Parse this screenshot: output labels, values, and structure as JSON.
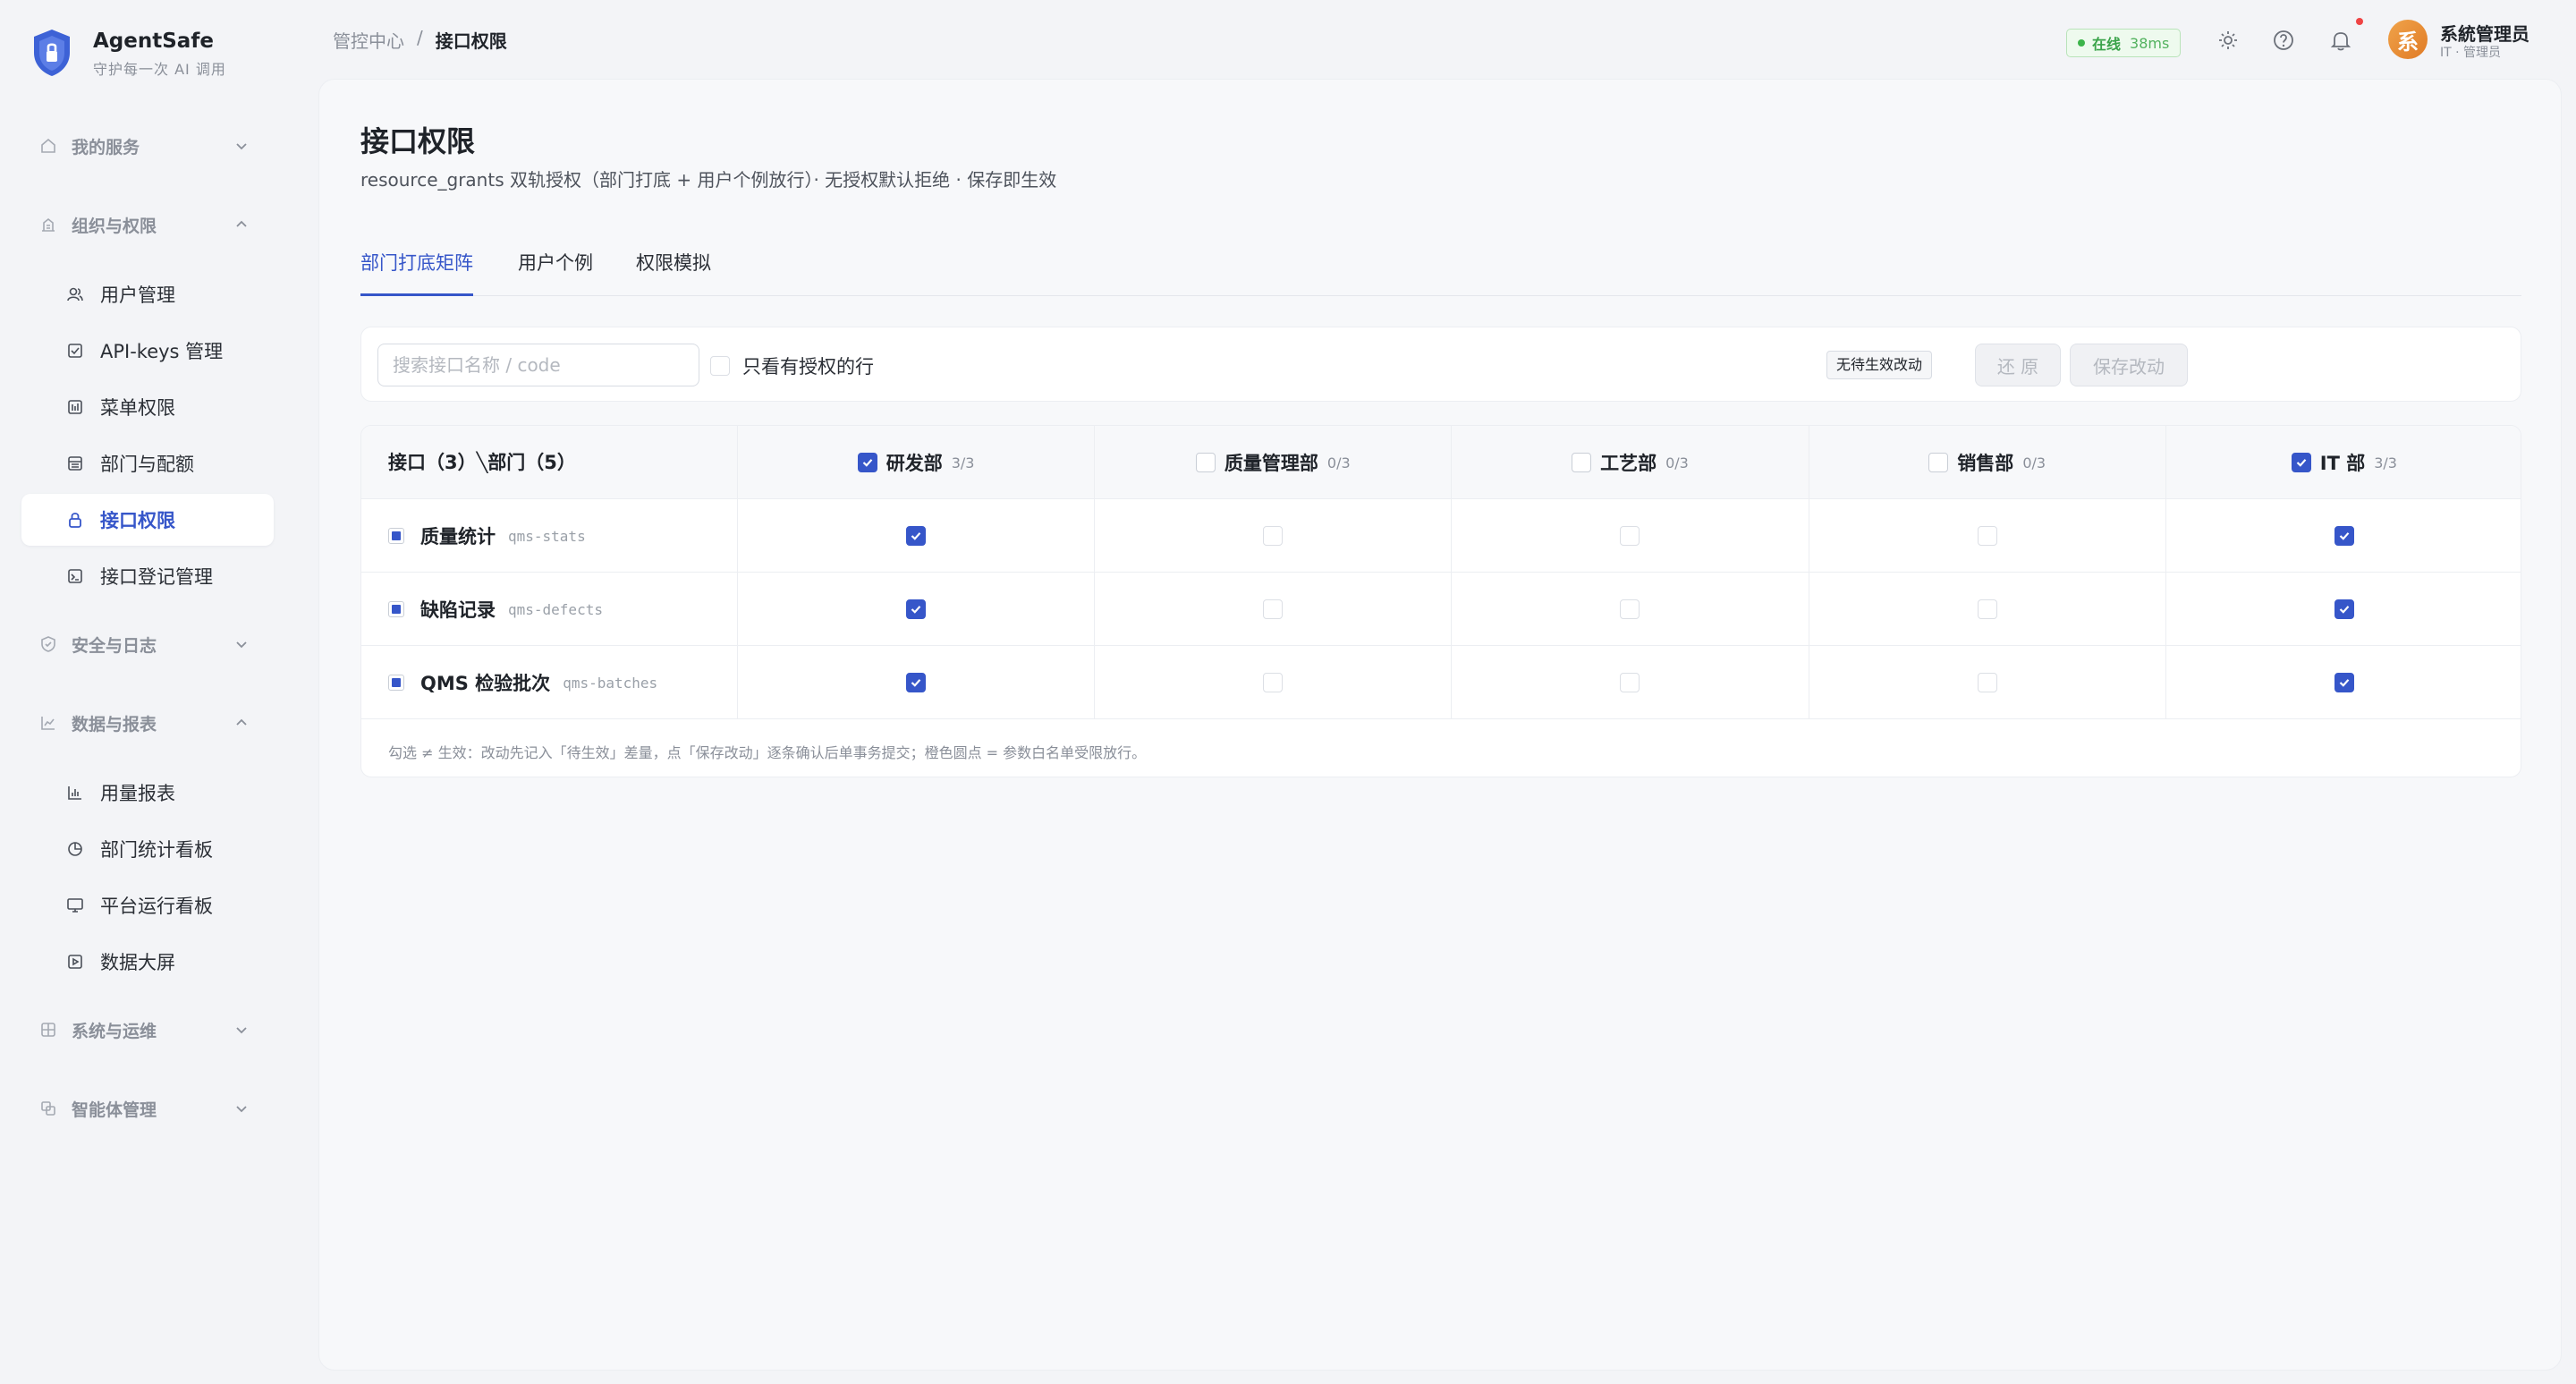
{
  "app": {
    "name": "AgentSafe",
    "slogan": "守护每一次 AI 调用"
  },
  "sidebar": {
    "groups": [
      {
        "label": "我的服务",
        "icon": "home-icon",
        "expanded": false
      },
      {
        "label": "组织与权限",
        "icon": "building-icon",
        "expanded": true,
        "items": [
          {
            "label": "用户管理",
            "icon": "users-icon"
          },
          {
            "label": "API-keys 管理",
            "icon": "key-check-icon"
          },
          {
            "label": "菜单权限",
            "icon": "menu-grid-icon"
          },
          {
            "label": "部门与配额",
            "icon": "department-icon"
          },
          {
            "label": "接口权限",
            "icon": "lock-icon",
            "active": true
          },
          {
            "label": "接口登记管理",
            "icon": "terminal-icon"
          }
        ]
      },
      {
        "label": "安全与日志",
        "icon": "shield-icon",
        "expanded": false
      },
      {
        "label": "数据与报表",
        "icon": "chart-line-icon",
        "expanded": true,
        "items": [
          {
            "label": "用量报表",
            "icon": "bar-chart-icon"
          },
          {
            "label": "部门统计看板",
            "icon": "pie-chart-icon"
          },
          {
            "label": "平台运行看板",
            "icon": "monitor-icon"
          },
          {
            "label": "数据大屏",
            "icon": "play-screen-icon"
          }
        ]
      },
      {
        "label": "系统与运维",
        "icon": "server-icon",
        "expanded": false
      },
      {
        "label": "智能体管理",
        "icon": "agent-icon",
        "expanded": false
      }
    ]
  },
  "breadcrumb": {
    "parent": "管控中心",
    "sep": "/",
    "current": "接口权限"
  },
  "topbar": {
    "status": "在线",
    "latency": "38ms",
    "status_color": "#3aa34a",
    "avatar_char": "系",
    "user_name": "系統管理员",
    "user_role": "IT · 管理员"
  },
  "page": {
    "title": "接口权限",
    "subtitle": "resource_grants 双轨授权（部门打底 + 用户个例放行）· 无授权默认拒绝 · 保存即生效"
  },
  "tabs": [
    {
      "label": "部门打底矩阵",
      "active": true
    },
    {
      "label": "用户个例",
      "active": false
    },
    {
      "label": "权限模拟",
      "active": false
    }
  ],
  "toolbar": {
    "search_placeholder": "搜索接口名称 / code",
    "search_value": "",
    "only_granted_label": "只看有授权的行",
    "only_granted_checked": false,
    "pending_label": "无待生效改动",
    "revert_label": "还 原",
    "save_label": "保存改动"
  },
  "matrix": {
    "corner": "接口（3）╲部门（5）",
    "departments": [
      {
        "name": "研发部",
        "count": "3/3",
        "all": true
      },
      {
        "name": "质量管理部",
        "count": "0/3",
        "all": false
      },
      {
        "name": "工艺部",
        "count": "0/3",
        "all": false
      },
      {
        "name": "销售部",
        "count": "0/3",
        "all": false
      },
      {
        "name": "IT 部",
        "count": "3/3",
        "all": true
      }
    ],
    "rows": [
      {
        "name": "质量统计",
        "code": "qms-stats",
        "grants": [
          true,
          false,
          false,
          false,
          true
        ]
      },
      {
        "name": "缺陷记录",
        "code": "qms-defects",
        "grants": [
          true,
          false,
          false,
          false,
          true
        ]
      },
      {
        "name": "QMS 检验批次",
        "code": "qms-batches",
        "grants": [
          true,
          false,
          false,
          false,
          true
        ]
      }
    ],
    "hint": "勾选 ≠ 生效：改动先记入「待生效」差量，点「保存改动」逐条确认后单事务提交；橙色圆点 = 参数白名单受限放行。"
  },
  "colors": {
    "accent": "#3656c9",
    "page_bg": "#f3f4f7",
    "card_bg": "#f7f8fa"
  }
}
